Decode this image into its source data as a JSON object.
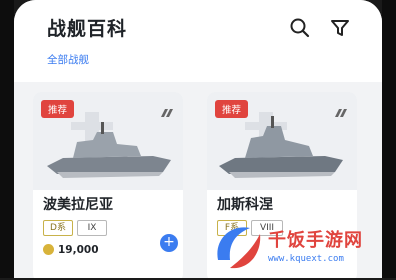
{
  "header": {
    "title": "战舰百科",
    "subtab": "全部战舰"
  },
  "icons": {
    "search": "search-icon",
    "filter": "filter-icon",
    "ship_type": "ship-type-icon",
    "coin": "coin-icon"
  },
  "cards": [
    {
      "badge": "推荐",
      "name": "波美拉尼亚",
      "class_tag": "D系",
      "tier": "IX",
      "price": "19,000"
    },
    {
      "badge": "推荐",
      "name": "加斯科涅",
      "class_tag": "F系",
      "tier": "VIII"
    }
  ],
  "watermark": {
    "text": "千饭手游网",
    "url": "www.kquext.com"
  },
  "colors": {
    "accent": "#3b7cf0",
    "badge": "#e0443e",
    "tag_gold": "#c8b24a"
  }
}
